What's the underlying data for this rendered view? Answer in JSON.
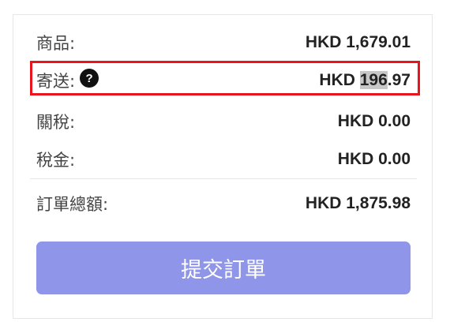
{
  "summary": {
    "items": {
      "label": "商品:",
      "value": "HKD 1,679.01"
    },
    "shipping": {
      "label": "寄送:",
      "help_icon": "?",
      "value_prefix": "HKD ",
      "value_selected": "196",
      "value_suffix": ".97"
    },
    "duties": {
      "label": "關稅:",
      "value": "HKD 0.00"
    },
    "tax": {
      "label": "稅金:",
      "value": "HKD 0.00"
    },
    "total": {
      "label": "訂單總額:",
      "value": "HKD 1,875.98"
    }
  },
  "submit_label": "提交訂單",
  "colors": {
    "highlight_border": "#e8161c",
    "button": "#8f95e8",
    "selection": "#c7c7c7"
  },
  "icons": {
    "help": "question-circle-icon"
  }
}
